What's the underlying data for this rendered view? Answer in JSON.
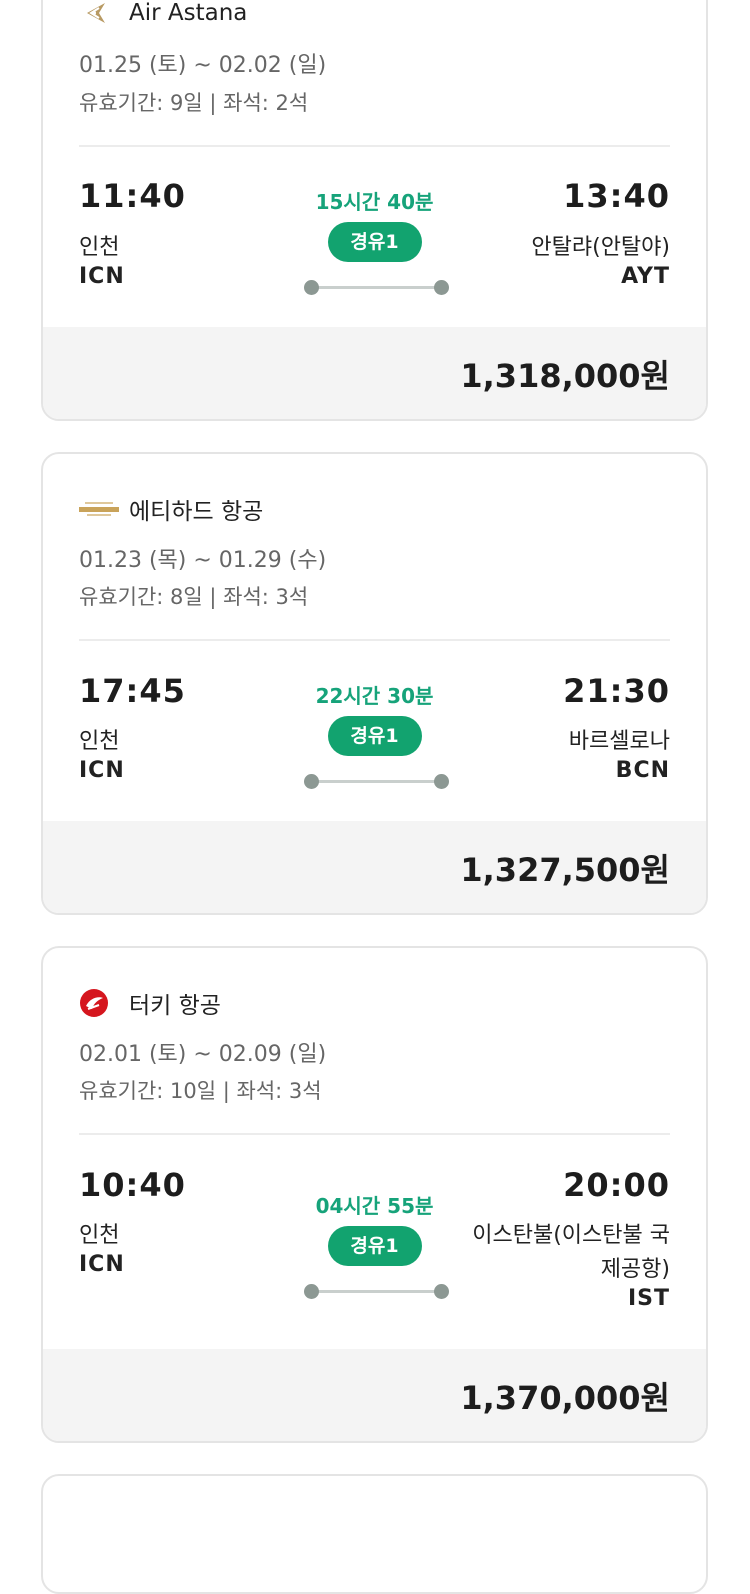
{
  "cards": [
    {
      "airline": "Air Astana",
      "logo": "air-astana-logo",
      "dates": "01.25 (토) ~ 02.02 (일)",
      "meta": "유효기간: 9일 | 좌석: 2석",
      "dep_time": "11:40",
      "dep_city": "인천",
      "dep_code": "ICN",
      "duration": "15시간 40분",
      "stops": "경유1",
      "arr_time": "13:40",
      "arr_city": "안탈랴(안탈야)",
      "arr_code": "AYT",
      "price": "1,318,000원"
    },
    {
      "airline": "에티하드 항공",
      "logo": "etihad-logo",
      "dates": "01.23 (목) ~ 01.29 (수)",
      "meta": "유효기간: 8일 | 좌석: 3석",
      "dep_time": "17:45",
      "dep_city": "인천",
      "dep_code": "ICN",
      "duration": "22시간 30분",
      "stops": "경유1",
      "arr_time": "21:30",
      "arr_city": "바르셀로나",
      "arr_code": "BCN",
      "price": "1,327,500원"
    },
    {
      "airline": "터키 항공",
      "logo": "turkish-airlines-logo",
      "dates": "02.01 (토) ~ 02.09 (일)",
      "meta": "유효기간: 10일 | 좌석: 3석",
      "dep_time": "10:40",
      "dep_city": "인천",
      "dep_code": "ICN",
      "duration": "04시간 55분",
      "stops": "경유1",
      "arr_time": "20:00",
      "arr_city_line1": "이스탄불(이스탄불 국",
      "arr_city_line2": "제공항)",
      "arr_code": "IST",
      "price": "1,370,000원"
    }
  ],
  "colors": {
    "accent": "#12a36f",
    "duration": "#16a37a",
    "price_bar": "#f4f4f4",
    "border": "#e4e4e4"
  }
}
